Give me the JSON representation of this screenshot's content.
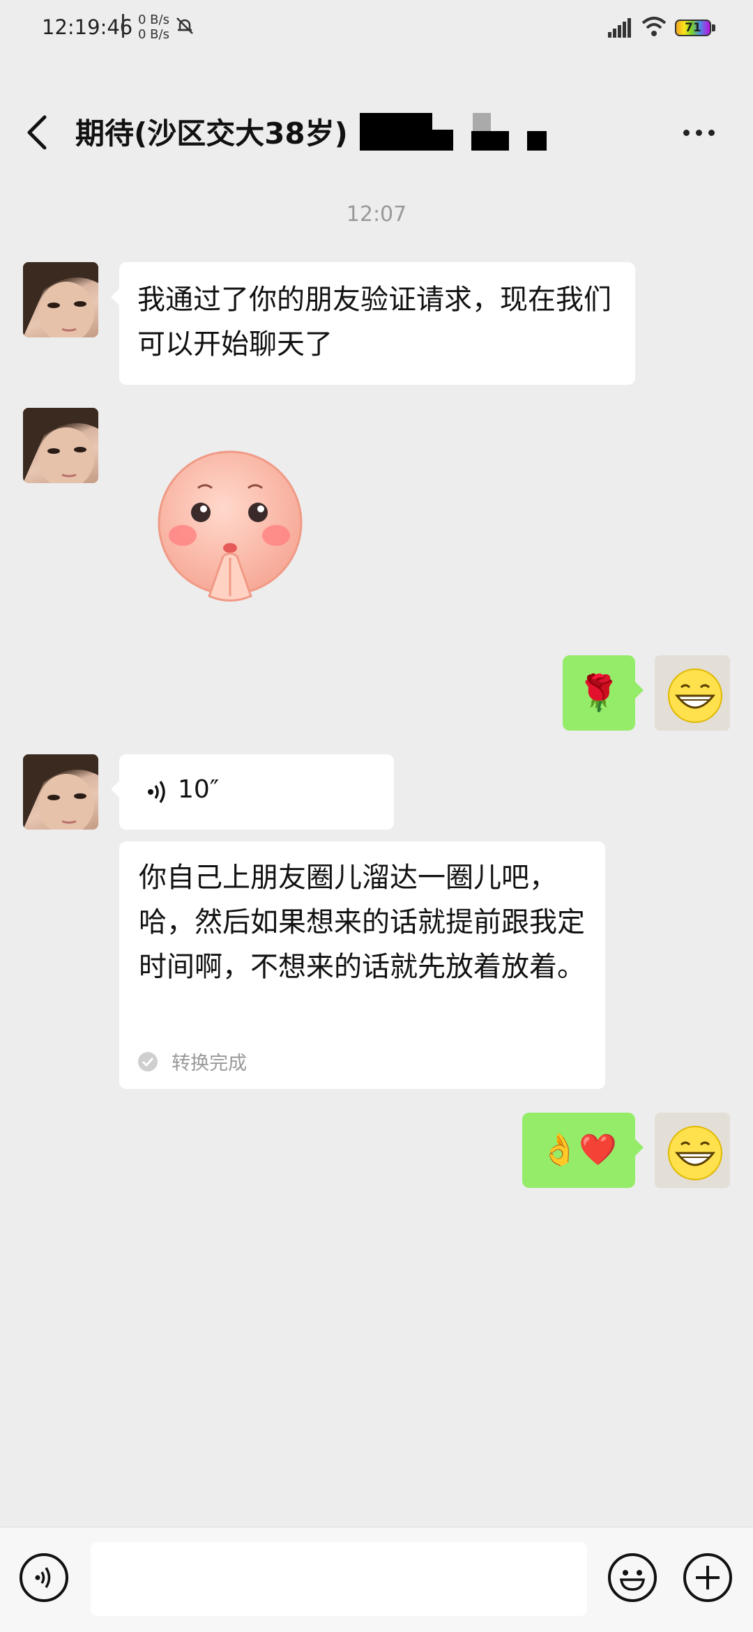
{
  "status": {
    "time": "12:19:46",
    "net_up": "0 B/s",
    "net_down": "0 B/s",
    "battery": "71"
  },
  "header": {
    "title": "期待(沙区交大38岁)"
  },
  "chat": {
    "timestamp": "12:07",
    "messages": [
      {
        "side": "left",
        "type": "text",
        "text": "我通过了你的朋友验证请求，现在我们可以开始聊天了"
      },
      {
        "side": "left",
        "type": "sticker",
        "sticker": "shy-pink-face-sticker"
      },
      {
        "side": "right",
        "type": "emoji",
        "emoji": "🌹"
      },
      {
        "side": "left",
        "type": "voice",
        "duration": "10″"
      },
      {
        "side": "left",
        "type": "transcript",
        "text": "你自己上朋友圈儿溜达一圈儿吧，哈，然后如果想来的话就提前跟我定时间啊，不想来的话就先放着放着。",
        "status": "转换完成"
      },
      {
        "side": "right",
        "type": "emoji",
        "emoji": "👌❤️"
      }
    ]
  },
  "colors": {
    "background": "#ededed",
    "bubble_self": "#95ec69",
    "bubble_other": "#ffffff"
  }
}
